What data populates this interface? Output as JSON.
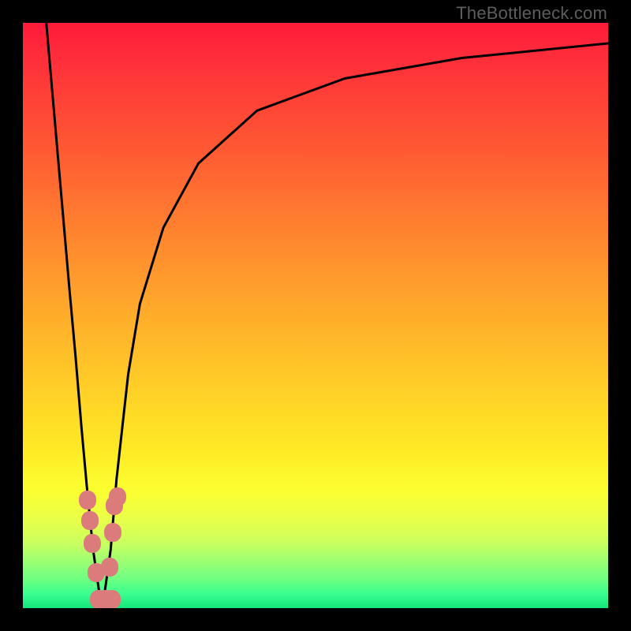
{
  "attribution": "TheBottleneck.com",
  "colors": {
    "frame": "#000000",
    "curve": "#000000",
    "marker": "#db7b7b",
    "gradient_top": "#ff1a3a",
    "gradient_bottom": "#14e57c"
  },
  "chart_data": {
    "type": "line",
    "title": "",
    "xlabel": "",
    "ylabel": "",
    "xlim": [
      0,
      100
    ],
    "ylim": [
      0,
      100
    ],
    "note": "Axes are unlabeled; x roughly represents component performance ratio and y represents bottleneck severity (0 = no bottleneck, 100 = severe). Values estimated from pixel positions.",
    "series": [
      {
        "name": "left-branch",
        "x": [
          4.0,
          6.0,
          8.0,
          9.0,
          10.0,
          11.0,
          12.0,
          13.0,
          13.6
        ],
        "y": [
          100,
          77,
          54,
          43,
          31,
          20,
          10,
          3,
          0
        ]
      },
      {
        "name": "right-branch",
        "x": [
          13.6,
          15.0,
          16.0,
          18.0,
          20.0,
          24.0,
          30.0,
          40.0,
          55.0,
          75.0,
          100.0
        ],
        "y": [
          0,
          10,
          22,
          40,
          52,
          65,
          76,
          85,
          90.5,
          94,
          96.5
        ]
      }
    ],
    "markers": {
      "name": "highlighted-points",
      "points": [
        {
          "x": 11.0,
          "y": 18.5
        },
        {
          "x": 11.5,
          "y": 15.0
        },
        {
          "x": 11.9,
          "y": 11.0
        },
        {
          "x": 12.5,
          "y": 6.0
        },
        {
          "x": 13.0,
          "y": 1.5
        },
        {
          "x": 14.2,
          "y": 1.5
        },
        {
          "x": 15.2,
          "y": 1.5
        },
        {
          "x": 14.8,
          "y": 7.0
        },
        {
          "x": 15.4,
          "y": 13.0
        },
        {
          "x": 15.6,
          "y": 17.5
        },
        {
          "x": 16.2,
          "y": 19.0
        }
      ]
    }
  }
}
